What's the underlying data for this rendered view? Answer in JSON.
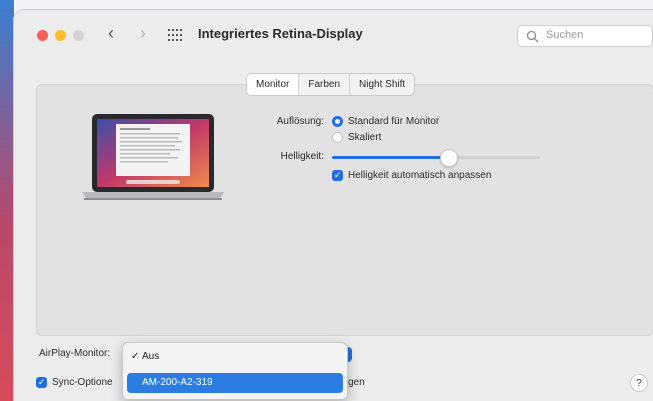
{
  "window": {
    "title": "Integriertes Retina-Display",
    "back_glyph": "‹",
    "forward_glyph": "›"
  },
  "search": {
    "placeholder": "Suchen"
  },
  "tabs": [
    {
      "label": "Monitor",
      "selected": true
    },
    {
      "label": "Farben",
      "selected": false
    },
    {
      "label": "Night Shift",
      "selected": false
    }
  ],
  "resolution": {
    "label": "Auflösung:",
    "options": [
      {
        "label": "Standard für Monitor",
        "selected": true
      },
      {
        "label": "Skaliert",
        "selected": false
      }
    ]
  },
  "brightness": {
    "label": "Helligkeit:",
    "value_fraction": 0.56,
    "auto_label": "Helligkeit automatisch anpassen",
    "auto_checked": true
  },
  "airplay": {
    "label": "AirPlay-Monitor:",
    "menu": [
      {
        "label": "Aus",
        "checked": true
      },
      {
        "label": "AM-200-A2-319",
        "highlighted": true
      }
    ]
  },
  "sync": {
    "label_visible": "Sync-Optione",
    "label_trailing": "gen",
    "checked": true
  },
  "help": {
    "glyph": "?"
  },
  "colors": {
    "accent": "#1f6fe3",
    "menu_highlight": "#2b7de1",
    "close": "#ff5f57",
    "minimize": "#febc2e"
  }
}
